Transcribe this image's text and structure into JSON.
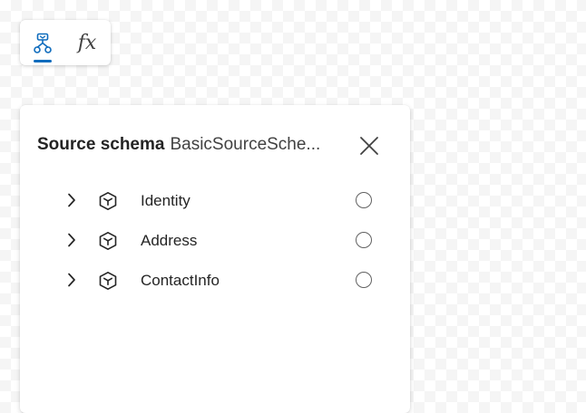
{
  "toolbar": {
    "buttons": [
      {
        "icon": "schema-tree-icon",
        "selected": true
      },
      {
        "icon": "function-fx-icon",
        "label": "fx",
        "selected": false
      }
    ],
    "accent_color": "#0f6cbd"
  },
  "panel": {
    "title": "Source schema",
    "subtitle": "BasicSourceSche...",
    "close_icon": "close-icon",
    "items": [
      {
        "label": "Identity",
        "icon": "cube-icon",
        "expand_icon": "chevron-right-icon",
        "checked": false
      },
      {
        "label": "Address",
        "icon": "cube-icon",
        "expand_icon": "chevron-right-icon",
        "checked": false
      },
      {
        "label": "ContactInfo",
        "icon": "cube-icon",
        "expand_icon": "chevron-right-icon",
        "checked": false
      }
    ]
  }
}
